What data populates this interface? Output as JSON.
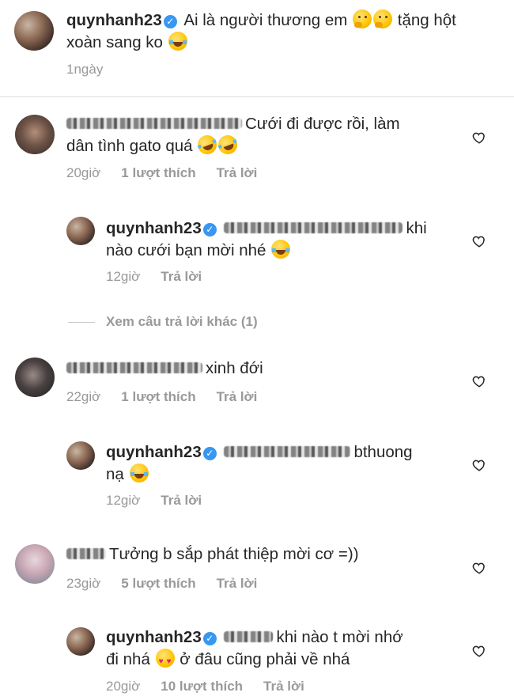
{
  "caption": {
    "username": "quynhanh23",
    "text_line1": "Ai là người thương em",
    "text_line1_after": "tặng hột",
    "text_line2": "xoàn sang ko",
    "time": "1ngày"
  },
  "comments": [
    {
      "text_line1": "Cưới đi được rồi, làm",
      "text_line2": "dân tình gato quá",
      "time": "20giờ",
      "likes": "1 lượt thích",
      "reply": "Trả lời",
      "reply_item": {
        "username": "quynhanh23",
        "text_line1": "khi",
        "text_line2": "nào cưới bạn mời nhé",
        "time": "12giờ",
        "reply": "Trả lời"
      },
      "more_replies": "Xem câu trả lời khác (1)"
    },
    {
      "text_line1": "xinh đới",
      "time": "22giờ",
      "likes": "1 lượt thích",
      "reply": "Trả lời",
      "reply_item": {
        "username": "quynhanh23",
        "text_line1": "bthuong",
        "text_line2": "nạ",
        "time": "12giờ",
        "reply": "Trả lời"
      }
    },
    {
      "text_line1": "Tưởng b sắp phát thiệp mời cơ =))",
      "time": "23giờ",
      "likes": "5 lượt thích",
      "reply": "Trả lời",
      "reply_item": {
        "username": "quynhanh23",
        "text_line1": "khi nào t mời nhớ",
        "text_line2_a": "đi nhá",
        "text_line2_b": "ở đâu cũng phải về nhá",
        "time": "20giờ",
        "likes": "10 lượt thích",
        "reply": "Trả lời"
      }
    }
  ],
  "icons": {
    "verified": "verified-badge-icon",
    "like": "heart-outline-icon"
  },
  "colors": {
    "verified": "#3897f0",
    "meta": "#999999",
    "text": "#262626"
  }
}
